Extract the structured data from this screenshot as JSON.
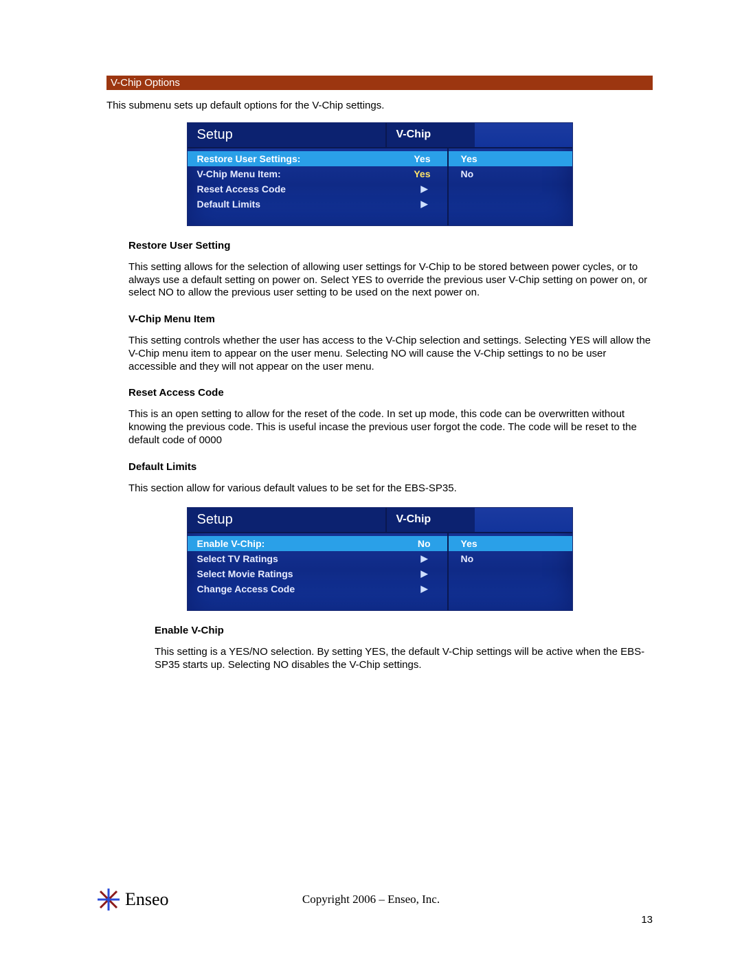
{
  "section_title": "V-Chip Options",
  "intro": "This submenu sets up default options for the V-Chip settings.",
  "osd1": {
    "setup_label": "Setup",
    "breadcrumb": "V-Chip",
    "rows": [
      {
        "label": "Restore User Settings:",
        "value": "Yes",
        "selected": true
      },
      {
        "label": "V-Chip Menu Item:",
        "value": "Yes",
        "selected": false
      },
      {
        "label": "Reset Access Code",
        "arrow": true,
        "selected": false
      },
      {
        "label": "Default Limits",
        "arrow": true,
        "selected": false
      }
    ],
    "options": [
      {
        "label": "Yes",
        "selected": true
      },
      {
        "label": "No",
        "selected": false
      }
    ]
  },
  "restore_heading": "Restore User Setting",
  "restore_body": "This setting allows for the selection of allowing user settings for V-Chip to be stored between power cycles, or to always use a default setting on power on.  Select YES to override the previous user V-Chip setting on power on, or select NO to allow the previous user setting to be used on the next power on.",
  "vchipmenu_heading": "V-Chip Menu Item",
  "vchipmenu_body": "This setting controls whether the user has access to the V-Chip selection and settings. Selecting YES will allow the V-Chip menu item to appear on the user menu. Selecting NO will cause the V-Chip settings to no be user accessible and they will not appear on the user menu.",
  "reset_heading": "Reset Access Code",
  "reset_body": "This is an open setting to allow for the reset of the code. In set up mode, this code can be overwritten without knowing the previous code. This is useful incase the previous user forgot the code. The code will be reset to the default code of 0000",
  "default_heading": "Default Limits",
  "default_body": "This section allow for various default values to be set for the EBS-SP35.",
  "osd2": {
    "setup_label": "Setup",
    "breadcrumb": "V-Chip",
    "rows": [
      {
        "label": "Enable V-Chip:",
        "value": "No",
        "selected": true
      },
      {
        "label": "Select TV Ratings",
        "arrow": true,
        "selected": false
      },
      {
        "label": "Select Movie Ratings",
        "arrow": true,
        "selected": false
      },
      {
        "label": "Change Access Code",
        "arrow": true,
        "selected": false
      }
    ],
    "options": [
      {
        "label": "Yes",
        "selected": true
      },
      {
        "label": "No",
        "selected": false
      }
    ]
  },
  "enable_heading": "Enable V-Chip",
  "enable_body": "This setting is a YES/NO selection. By setting YES, the default V-Chip settings will be active when the EBS-SP35 starts up.  Selecting NO disables the V-Chip settings.",
  "footer": {
    "logo_text": "Enseo",
    "copyright": "Copyright 2006 – Enseo, Inc.",
    "page_number": "13"
  }
}
